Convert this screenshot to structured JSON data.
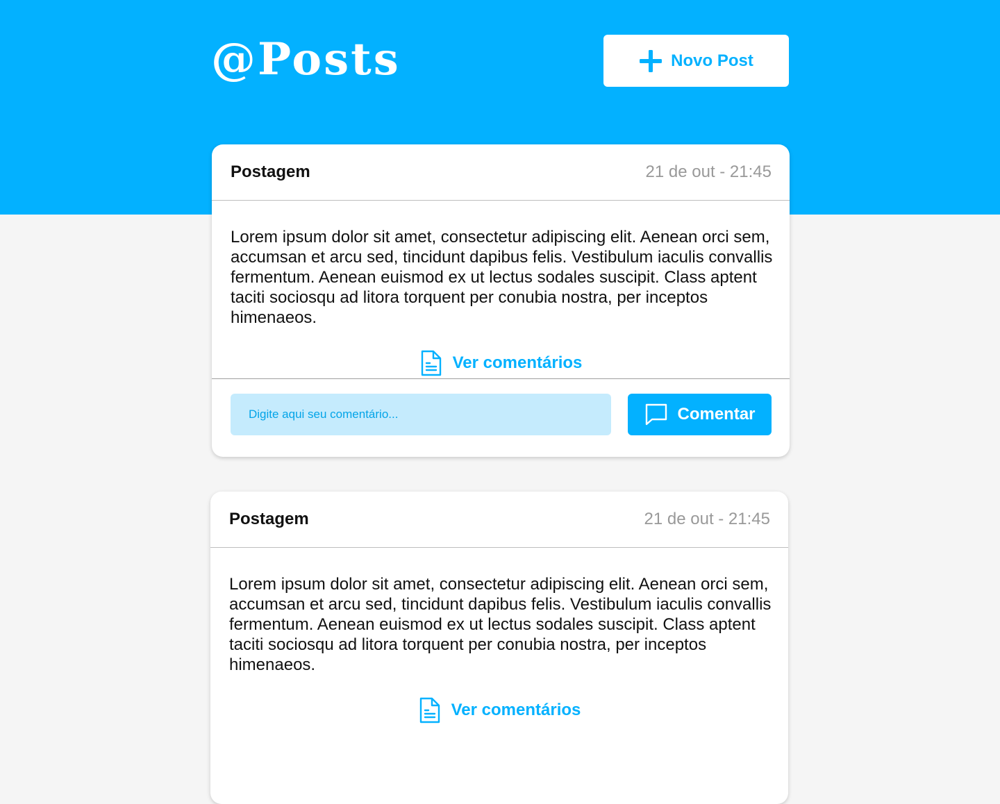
{
  "header": {
    "brand": "@Posts",
    "new_post_label": "Novo Post",
    "new_post_icon": "plus-icon",
    "background": "#03b1ff"
  },
  "posts": [
    {
      "title": "Postagem",
      "date": "21 de out - 21:45",
      "body": "Lorem ipsum dolor sit amet, consectetur adipiscing elit. Aenean orci sem, accumsan et arcu sed, tincidunt dapibus felis. Vestibulum iaculis convallis fermentum. Aenean euismod ex ut lectus sodales suscipit. Class aptent taciti sociosqu ad litora torquent per conubia nostra, per inceptos himenaeos.",
      "comments_label": "Ver comentários",
      "comments_icon": "document-icon",
      "comment_placeholder": "Digite aqui seu comentário...",
      "comment_button_label": "Comentar",
      "comment_button_icon": "chat-bubble-icon"
    },
    {
      "title": "Postagem",
      "date": "21 de out - 21:45",
      "body": "Lorem ipsum dolor sit amet, consectetur adipiscing elit. Aenean orci sem, accumsan et arcu sed, tincidunt dapibus felis. Vestibulum iaculis convallis fermentum. Aenean euismod ex ut lectus sodales suscipit. Class aptent taciti sociosqu ad litora torquent per conubia nostra, per inceptos himenaeos.",
      "comments_label": "Ver comentários",
      "comments_icon": "document-icon"
    }
  ],
  "colors": {
    "accent": "#03b1ff",
    "input_bg": "#c5ebfd",
    "page_bg": "#f5f5f5",
    "muted_text": "#999999"
  }
}
